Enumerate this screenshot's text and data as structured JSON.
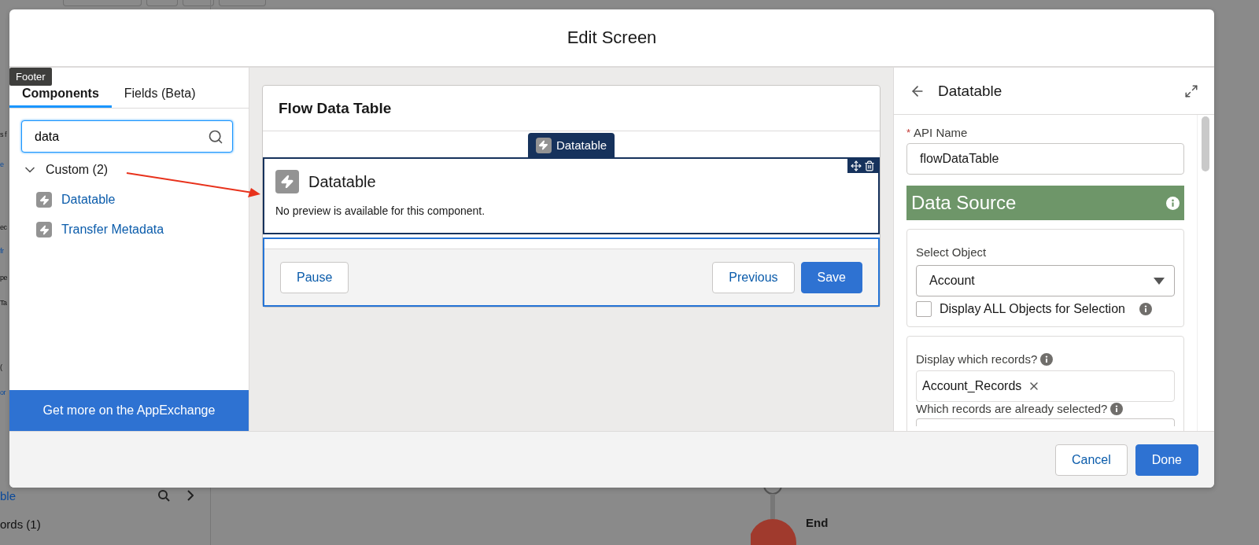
{
  "background": {
    "side_fragments": [
      {
        "text": "s f",
        "kind": "text"
      },
      {
        "text": "e",
        "kind": "link"
      },
      {
        "text": "ec",
        "kind": "text"
      },
      {
        "text": "fr",
        "kind": "link"
      },
      {
        "text": "pe",
        "kind": "text"
      },
      {
        "text": "Ta",
        "kind": "text"
      },
      {
        "text": "(",
        "kind": "text"
      },
      {
        "text": "or",
        "kind": "link"
      }
    ],
    "bottom_rows": [
      {
        "text": "ble",
        "kind": "link"
      },
      {
        "text": "ords (1)",
        "kind": "text"
      }
    ],
    "end_node": {
      "label": "End"
    }
  },
  "dialog": {
    "title": "Edit Screen",
    "tooltip": "Footer",
    "tabs": [
      {
        "label": "Components",
        "selected": true
      },
      {
        "label": "Fields (Beta)",
        "selected": false
      }
    ],
    "search": {
      "value": "data"
    },
    "tree": [
      {
        "label": "Custom (2)",
        "expanded": true,
        "children": [
          {
            "label": "Datatable"
          },
          {
            "label": "Transfer Metadata"
          }
        ]
      }
    ],
    "appexchange_button": "Get more on the AppExchange",
    "canvas": {
      "screen_title": "Flow Data Table",
      "component_tab": "Datatable",
      "component": {
        "title": "Datatable",
        "message": "No preview is available for this component."
      },
      "footer_buttons": [
        {
          "label": "Pause",
          "kind": "neutral"
        },
        {
          "label": "Previous",
          "kind": "neutral"
        },
        {
          "label": "Save",
          "kind": "brand"
        }
      ]
    },
    "properties": {
      "title": "Datatable",
      "api_name": {
        "label": "API Name",
        "required_mark": "*",
        "value": "flowDataTable"
      },
      "section": "Data Source",
      "select_object": {
        "label": "Select Object",
        "value": "Account",
        "checkbox": {
          "label": "Display ALL Objects for Selection",
          "checked": false
        }
      },
      "records": {
        "label": "Display which records?",
        "pill": "Account_Records",
        "selected_label": "Which records are already selected?"
      }
    },
    "footer_buttons": [
      {
        "label": "Cancel",
        "kind": "neutral"
      },
      {
        "label": "Done",
        "kind": "brand"
      }
    ]
  }
}
